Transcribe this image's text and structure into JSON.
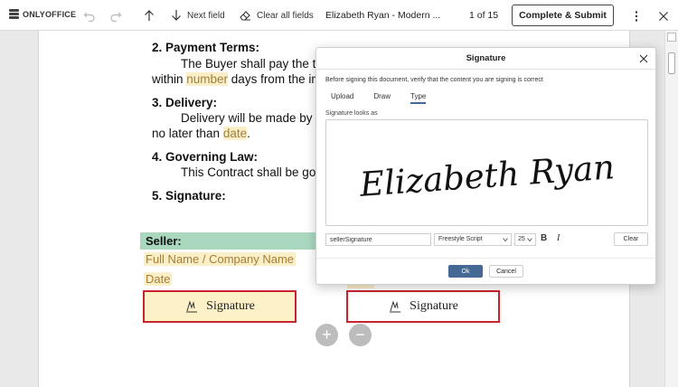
{
  "app": {
    "brand": "ONLYOFFICE"
  },
  "toolbar": {
    "undo_icon": "undo-icon",
    "redo_icon": "redo-icon",
    "prev_field_icon": "arrow-up-icon",
    "next_field_label": "Next field",
    "clear_fields_label": "Clear all fields",
    "doc_title": "Elizabeth Ryan - Modern ...",
    "page_indicator": "1 of 15",
    "submit_label": "Complete & Submit"
  },
  "document": {
    "section2_heading": "2. Payment Terms:",
    "section2_line1": "The Buyer shall pay the to",
    "section2_line2_pre": "within ",
    "section2_line2_field": "number",
    "section2_line2_post": " days from the in",
    "section3_heading": "3. Delivery:",
    "section3_line1": "Delivery will be made by",
    "section3_line2_pre": "no later than ",
    "section3_line2_field": "date",
    "section3_line2_post": ".",
    "section4_heading": "4. Governing Law:",
    "section4_line1": "This Contract shall be gov",
    "section5_heading": "5. Signature:",
    "seller_label": "Seller:",
    "fullname_placeholder": "Full Name / Company Name",
    "date_placeholder": "Date",
    "sig_left_label": "Signature",
    "sig_right_label": "Signature",
    "zoom_in": "+",
    "zoom_out": "−"
  },
  "dialog": {
    "title": "Signature",
    "description": "Before signing this document, verify that the content you are signing is correct",
    "tabs": [
      "Upload",
      "Draw",
      "Type"
    ],
    "active_tab": "Type",
    "preview_label": "Signature looks as",
    "signature_text": "Elizabeth Ryan",
    "name_input_value": "sellerSignature",
    "font_value": "Freestyle Script",
    "size_value": "25",
    "bold_label": "B",
    "italic_label": "I",
    "clear_label": "Clear",
    "ok_label": "Ok",
    "cancel_label": "Cancel"
  },
  "colors": {
    "accent": "#446995",
    "field_highlight": "#fbefc8",
    "seller_bar": "#a9d8bf",
    "required_border": "#c9232d"
  }
}
